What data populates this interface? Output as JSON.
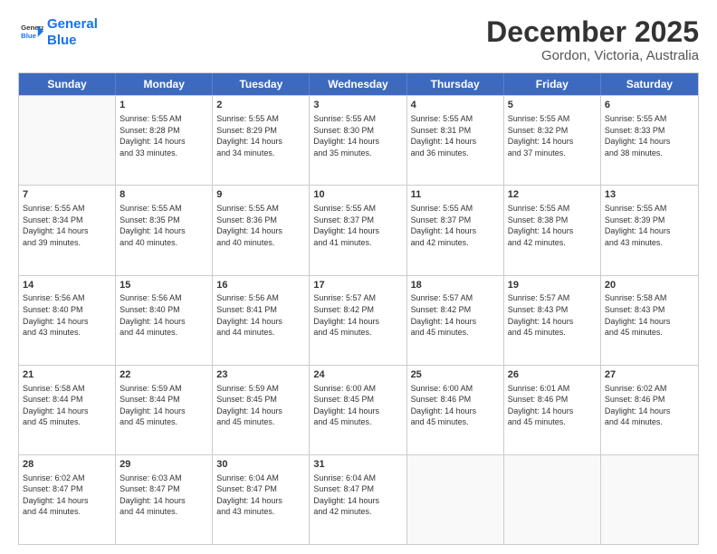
{
  "logo": {
    "line1": "General",
    "line2": "Blue"
  },
  "title": "December 2025",
  "subtitle": "Gordon, Victoria, Australia",
  "days": [
    "Sunday",
    "Monday",
    "Tuesday",
    "Wednesday",
    "Thursday",
    "Friday",
    "Saturday"
  ],
  "weeks": [
    [
      {
        "day": "",
        "info": ""
      },
      {
        "day": "1",
        "info": "Sunrise: 5:55 AM\nSunset: 8:28 PM\nDaylight: 14 hours\nand 33 minutes."
      },
      {
        "day": "2",
        "info": "Sunrise: 5:55 AM\nSunset: 8:29 PM\nDaylight: 14 hours\nand 34 minutes."
      },
      {
        "day": "3",
        "info": "Sunrise: 5:55 AM\nSunset: 8:30 PM\nDaylight: 14 hours\nand 35 minutes."
      },
      {
        "day": "4",
        "info": "Sunrise: 5:55 AM\nSunset: 8:31 PM\nDaylight: 14 hours\nand 36 minutes."
      },
      {
        "day": "5",
        "info": "Sunrise: 5:55 AM\nSunset: 8:32 PM\nDaylight: 14 hours\nand 37 minutes."
      },
      {
        "day": "6",
        "info": "Sunrise: 5:55 AM\nSunset: 8:33 PM\nDaylight: 14 hours\nand 38 minutes."
      }
    ],
    [
      {
        "day": "7",
        "info": "Sunrise: 5:55 AM\nSunset: 8:34 PM\nDaylight: 14 hours\nand 39 minutes."
      },
      {
        "day": "8",
        "info": "Sunrise: 5:55 AM\nSunset: 8:35 PM\nDaylight: 14 hours\nand 40 minutes."
      },
      {
        "day": "9",
        "info": "Sunrise: 5:55 AM\nSunset: 8:36 PM\nDaylight: 14 hours\nand 40 minutes."
      },
      {
        "day": "10",
        "info": "Sunrise: 5:55 AM\nSunset: 8:37 PM\nDaylight: 14 hours\nand 41 minutes."
      },
      {
        "day": "11",
        "info": "Sunrise: 5:55 AM\nSunset: 8:37 PM\nDaylight: 14 hours\nand 42 minutes."
      },
      {
        "day": "12",
        "info": "Sunrise: 5:55 AM\nSunset: 8:38 PM\nDaylight: 14 hours\nand 42 minutes."
      },
      {
        "day": "13",
        "info": "Sunrise: 5:55 AM\nSunset: 8:39 PM\nDaylight: 14 hours\nand 43 minutes."
      }
    ],
    [
      {
        "day": "14",
        "info": "Sunrise: 5:56 AM\nSunset: 8:40 PM\nDaylight: 14 hours\nand 43 minutes."
      },
      {
        "day": "15",
        "info": "Sunrise: 5:56 AM\nSunset: 8:40 PM\nDaylight: 14 hours\nand 44 minutes."
      },
      {
        "day": "16",
        "info": "Sunrise: 5:56 AM\nSunset: 8:41 PM\nDaylight: 14 hours\nand 44 minutes."
      },
      {
        "day": "17",
        "info": "Sunrise: 5:57 AM\nSunset: 8:42 PM\nDaylight: 14 hours\nand 45 minutes."
      },
      {
        "day": "18",
        "info": "Sunrise: 5:57 AM\nSunset: 8:42 PM\nDaylight: 14 hours\nand 45 minutes."
      },
      {
        "day": "19",
        "info": "Sunrise: 5:57 AM\nSunset: 8:43 PM\nDaylight: 14 hours\nand 45 minutes."
      },
      {
        "day": "20",
        "info": "Sunrise: 5:58 AM\nSunset: 8:43 PM\nDaylight: 14 hours\nand 45 minutes."
      }
    ],
    [
      {
        "day": "21",
        "info": "Sunrise: 5:58 AM\nSunset: 8:44 PM\nDaylight: 14 hours\nand 45 minutes."
      },
      {
        "day": "22",
        "info": "Sunrise: 5:59 AM\nSunset: 8:44 PM\nDaylight: 14 hours\nand 45 minutes."
      },
      {
        "day": "23",
        "info": "Sunrise: 5:59 AM\nSunset: 8:45 PM\nDaylight: 14 hours\nand 45 minutes."
      },
      {
        "day": "24",
        "info": "Sunrise: 6:00 AM\nSunset: 8:45 PM\nDaylight: 14 hours\nand 45 minutes."
      },
      {
        "day": "25",
        "info": "Sunrise: 6:00 AM\nSunset: 8:46 PM\nDaylight: 14 hours\nand 45 minutes."
      },
      {
        "day": "26",
        "info": "Sunrise: 6:01 AM\nSunset: 8:46 PM\nDaylight: 14 hours\nand 45 minutes."
      },
      {
        "day": "27",
        "info": "Sunrise: 6:02 AM\nSunset: 8:46 PM\nDaylight: 14 hours\nand 44 minutes."
      }
    ],
    [
      {
        "day": "28",
        "info": "Sunrise: 6:02 AM\nSunset: 8:47 PM\nDaylight: 14 hours\nand 44 minutes."
      },
      {
        "day": "29",
        "info": "Sunrise: 6:03 AM\nSunset: 8:47 PM\nDaylight: 14 hours\nand 44 minutes."
      },
      {
        "day": "30",
        "info": "Sunrise: 6:04 AM\nSunset: 8:47 PM\nDaylight: 14 hours\nand 43 minutes."
      },
      {
        "day": "31",
        "info": "Sunrise: 6:04 AM\nSunset: 8:47 PM\nDaylight: 14 hours\nand 42 minutes."
      },
      {
        "day": "",
        "info": ""
      },
      {
        "day": "",
        "info": ""
      },
      {
        "day": "",
        "info": ""
      }
    ]
  ]
}
